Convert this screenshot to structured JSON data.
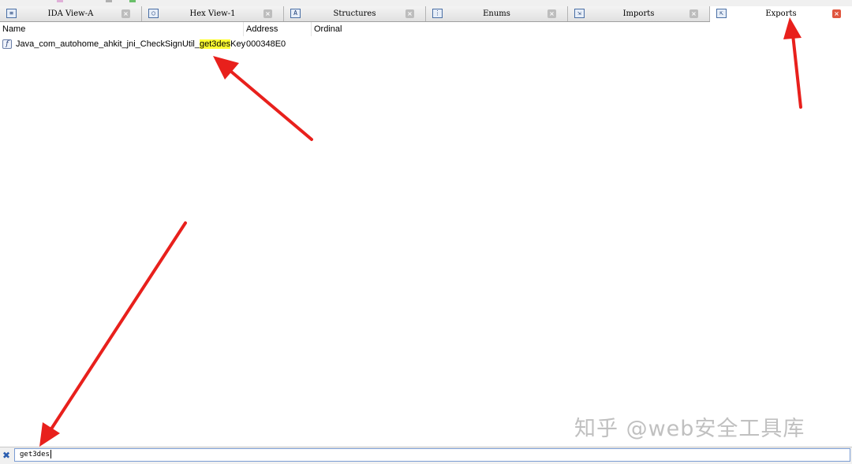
{
  "tabs": [
    {
      "label": "IDA View-A",
      "icon": "ida-view-icon",
      "glyph": "≡",
      "active": false
    },
    {
      "label": "Hex View-1",
      "icon": "hex-view-icon",
      "glyph": "○",
      "active": false
    },
    {
      "label": "Structures",
      "icon": "structures-icon",
      "glyph": "A",
      "active": false
    },
    {
      "label": "Enums",
      "icon": "enums-icon",
      "glyph": "⋮",
      "active": false
    },
    {
      "label": "Imports",
      "icon": "imports-icon",
      "glyph": "⇲",
      "active": false
    },
    {
      "label": "Exports",
      "icon": "exports-icon",
      "glyph": "⇱",
      "active": true
    }
  ],
  "close_glyph": "×",
  "columns": {
    "name": "Name",
    "address": "Address",
    "ordinal": "Ordinal"
  },
  "exports": [
    {
      "name_prefix": "Java_com_autohome_ahkit_jni_CheckSignUtil_",
      "name_highlight": "get3des",
      "name_suffix": "Key",
      "address": "000348E0",
      "ordinal": "",
      "icon": "function-icon",
      "icon_glyph": "f"
    }
  ],
  "search": {
    "value": "get3des",
    "close_glyph": "✖"
  },
  "watermark": "知乎 @web安全工具库",
  "colors": {
    "highlight": "#ffff33",
    "arrow": "#e8201c",
    "active_close": "#e0563f"
  }
}
